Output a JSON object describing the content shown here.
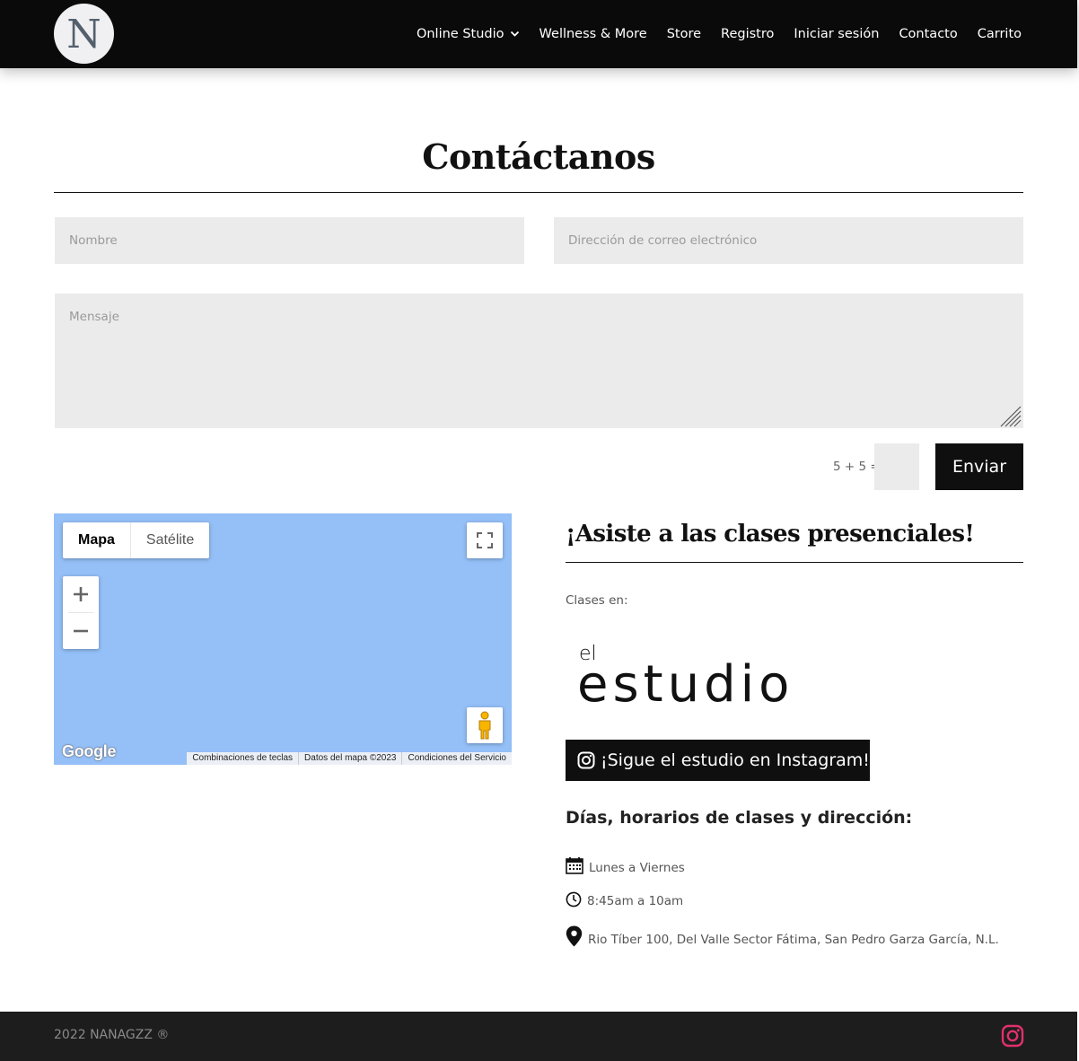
{
  "header": {
    "logo_letter": "N",
    "nav": [
      {
        "label": "Online Studio",
        "has_dropdown": true
      },
      {
        "label": "Wellness & More"
      },
      {
        "label": "Store"
      },
      {
        "label": "Registro"
      },
      {
        "label": "Iniciar sesión"
      },
      {
        "label": "Contacto"
      },
      {
        "label": "Carrito"
      }
    ]
  },
  "page": {
    "title": "Contáctanos"
  },
  "form": {
    "name_placeholder": "Nombre",
    "email_placeholder": "Dirección de correo electrónico",
    "message_placeholder": "Mensaje",
    "captcha_label": "5 + 5 =",
    "captcha_value": "",
    "submit_label": "Enviar"
  },
  "map": {
    "type_map": "Mapa",
    "type_satellite": "Satélite",
    "google": "Google",
    "footer": [
      "Combinaciones de teclas",
      "Datos del mapa ©2023",
      "Condiciones del Servicio"
    ]
  },
  "classes": {
    "heading": "¡Asiste a las clases presenciales!",
    "classes_at": "Clases en:",
    "studio_logo_small": "el",
    "studio_logo_big": "estudio",
    "instagram_button": "¡Sigue el estudio en Instagram!",
    "schedule_heading": "Días, horarios de clases y dirección:",
    "days": "Lunes a Viernes",
    "hours": "8:45am a 10am",
    "address": "Rio Tíber 100, Del Valle Sector Fátima, San Pedro Garza García, N.L."
  },
  "footer": {
    "copyright": "2022 NANAGZZ ®"
  },
  "colors": {
    "header_bg": "#0a0a0a",
    "field_bg": "#ebebeb",
    "map_water": "#94bff7",
    "footer_bg": "#1d1d1d",
    "instagram_footer": "#e1306c"
  }
}
